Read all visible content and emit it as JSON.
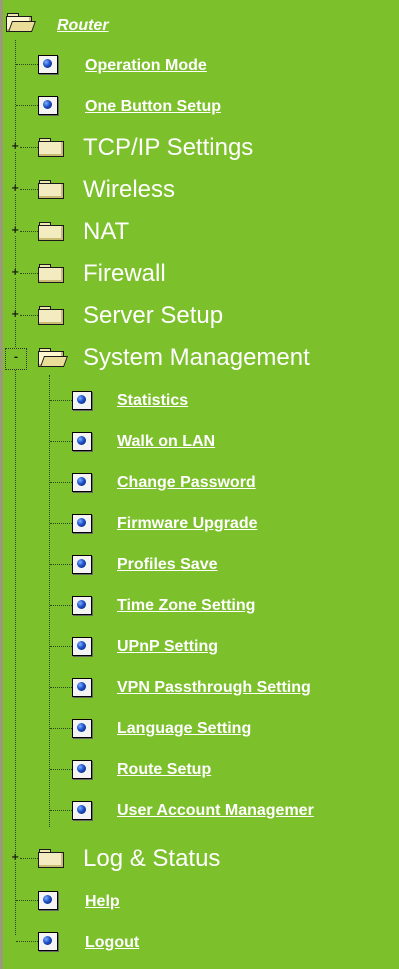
{
  "tree": {
    "root": {
      "label": "Router"
    },
    "top_items": [
      {
        "label": "Operation Mode",
        "kind": "page"
      },
      {
        "label": "One Button Setup",
        "kind": "page"
      },
      {
        "label": "TCP/IP Settings",
        "kind": "folder",
        "expander": "+"
      },
      {
        "label": "Wireless",
        "kind": "folder",
        "expander": "+"
      },
      {
        "label": "NAT",
        "kind": "folder",
        "expander": "+"
      },
      {
        "label": "Firewall",
        "kind": "folder",
        "expander": "+"
      },
      {
        "label": "Server Setup",
        "kind": "folder",
        "expander": "+"
      },
      {
        "label": "System Management",
        "kind": "folder-open",
        "expander": "-"
      }
    ],
    "system_management_items": [
      {
        "label": "Statistics"
      },
      {
        "label": "Walk on LAN"
      },
      {
        "label": "Change Password"
      },
      {
        "label": "Firmware Upgrade"
      },
      {
        "label": "Profiles Save"
      },
      {
        "label": "Time Zone Setting"
      },
      {
        "label": "UPnP Setting"
      },
      {
        "label": "VPN Passthrough Setting"
      },
      {
        "label": "Language Setting"
      },
      {
        "label": "Route Setup"
      },
      {
        "label": "User Account Managemer"
      }
    ],
    "bottom_items": [
      {
        "label": "Log & Status",
        "kind": "folder",
        "expander": "+"
      },
      {
        "label": "Help",
        "kind": "page"
      },
      {
        "label": "Logout",
        "kind": "page"
      }
    ]
  },
  "colors": {
    "background": "#7cc02b",
    "text": "#ffffff"
  }
}
